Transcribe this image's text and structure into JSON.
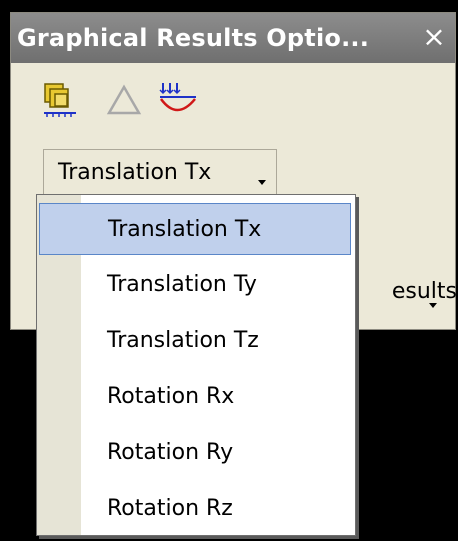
{
  "window": {
    "title": "Graphical Results Optio...",
    "close_glyph": "×"
  },
  "toolbar": {
    "icons": [
      "stacked-results-icon",
      "triangle-icon",
      "deformation-icon"
    ],
    "colors": {
      "accent_blue": "#1e32c8",
      "accent_red": "#d01818",
      "icon_yellow": "#e8c830"
    }
  },
  "dropdown": {
    "selected": "Translation Tx",
    "options": [
      "Translation Tx",
      "Translation Ty",
      "Translation Tz",
      "Rotation Rx",
      "Rotation Ry",
      "Rotation Rz"
    ]
  },
  "hidden_control": {
    "visible_text": "esults"
  },
  "colors": {
    "selection_bg": "#c0d0ec",
    "selection_border": "#5a86c8",
    "panel_bg": "#ece9d8",
    "titlebar": "#7d7d7d"
  }
}
